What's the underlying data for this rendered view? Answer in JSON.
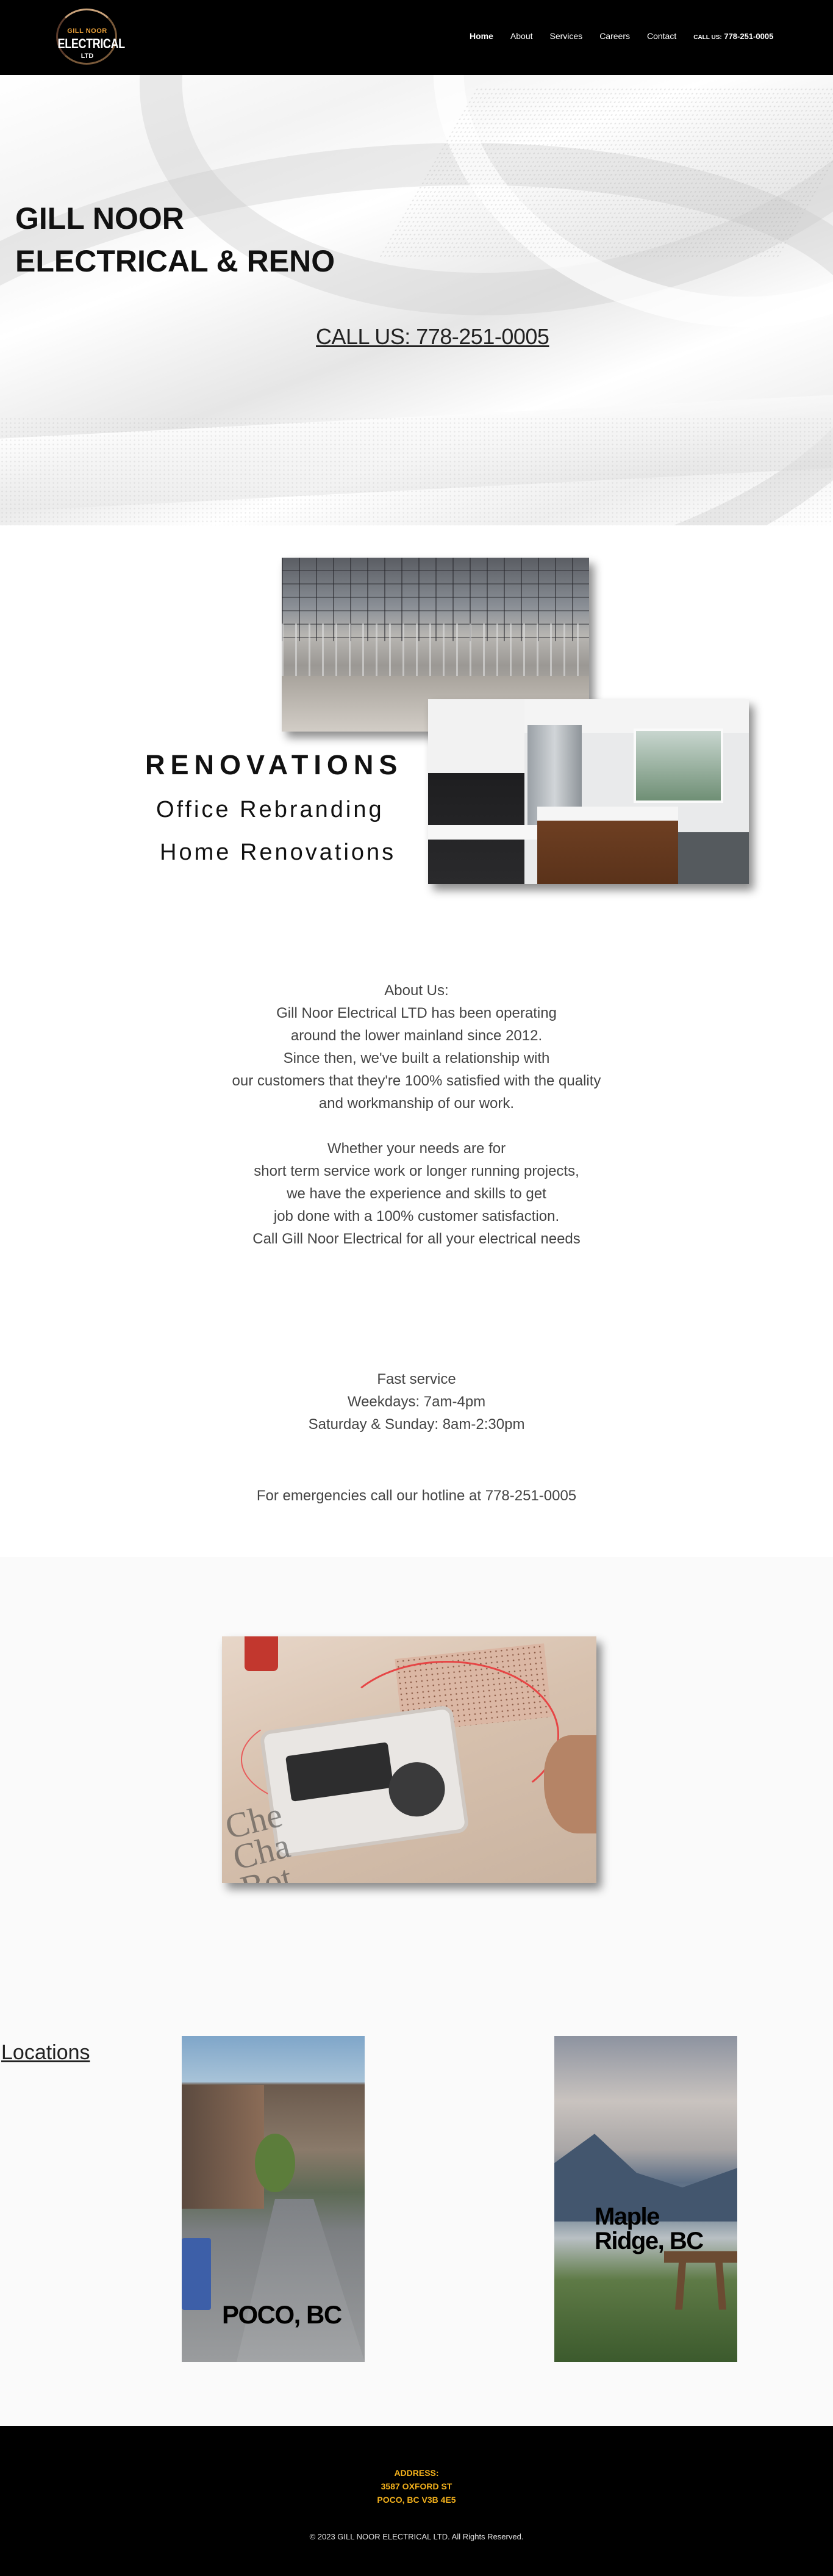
{
  "brand": {
    "logo_top": "GILL NOOR",
    "logo_mid": "ELECTRICAL",
    "logo_bot": "LTD"
  },
  "nav": {
    "items": [
      {
        "label": "Home",
        "active": true
      },
      {
        "label": "About"
      },
      {
        "label": "Services"
      },
      {
        "label": "Careers"
      },
      {
        "label": "Contact"
      }
    ],
    "call_prefix": "CALL US:",
    "call_number": "778-251-0005"
  },
  "hero": {
    "title_line1": "GILL NOOR",
    "title_line2": "ELECTRICAL & RENO",
    "call_text": "CALL US: 778-251-0005"
  },
  "renovations": {
    "title": "RENOVATIONS",
    "line1": "Office Rebranding",
    "line2": "Home Renovations"
  },
  "about": {
    "lines_1": [
      "About Us:",
      "Gill Noor Electrical LTD has been operating",
      "around the lower mainland since 2012.",
      "Since then, we've built a relationship with",
      "our customers that they're 100% satisfied with the quality",
      "and workmanship of our work."
    ],
    "lines_2": [
      "Whether your needs are for",
      "short term service work or longer running projects,",
      "we have the experience and skills to get",
      "job done with a 100% customer satisfaction.",
      "Call Gill Noor Electrical for all your electrical needs"
    ]
  },
  "hours": {
    "lines": [
      "Fast service",
      "Weekdays: 7am-4pm",
      "Saturday & Sunday: 8am-2:30pm"
    ],
    "hotline": "For emergencies call our hotline at 778-251-0005"
  },
  "locations": {
    "label": "Locations",
    "items": [
      {
        "line1": "POCO, BC"
      },
      {
        "line1": "Maple",
        "line2": "Ridge, BC"
      }
    ]
  },
  "footer": {
    "address_label": "ADDRESS:",
    "address_line1": "3587 OXFORD ST",
    "address_line2": "POCO, BC V3B 4E5",
    "copyright": "© 2023 GILL NOOR ELECTRICAL LTD. All Rights Reserved."
  },
  "colors": {
    "header_bg": "#000000",
    "footer_accent": "#f3b11c",
    "logo_accent": "#f0a43a"
  }
}
